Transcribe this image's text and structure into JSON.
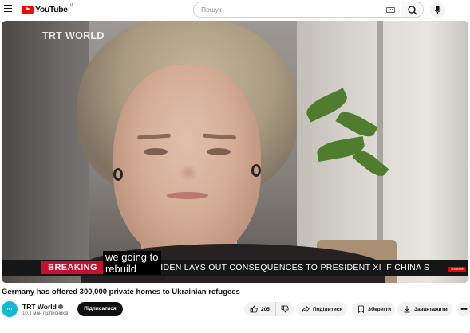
{
  "masthead": {
    "logo_text": "YouTube",
    "country_code": "UA",
    "search_placeholder": "Пошук"
  },
  "player": {
    "channel_bug": "TRT WORLD",
    "breaking_label": "BREAKING",
    "ticker_text": "BIDEN LAYS OUT CONSEQUENCES TO PRESIDENT XI IF CHINA S",
    "captions": [
      "we going to",
      "rebuild"
    ],
    "subscribe_badge": "Subscribe"
  },
  "video": {
    "title": "Germany has offered 300,000 private homes to Ukrainian refugees"
  },
  "owner": {
    "avatar_text": "TRT WORLD",
    "channel_name": "TRT World",
    "subscribers": "10,1 млн підписників",
    "subscribe_label": "Підписатися"
  },
  "actions": {
    "like_count": "205",
    "share_label": "Поділитися",
    "save_label": "Зберегти",
    "download_label": "Завантажити",
    "more_label": "•••"
  },
  "icons": [
    "menu-icon",
    "youtube-logo-icon",
    "keyboard-icon",
    "search-icon",
    "mic-icon",
    "verified-icon",
    "thumb-up-icon",
    "thumb-down-icon",
    "share-icon",
    "bookmark-icon",
    "download-icon",
    "more-icon"
  ],
  "colors": {
    "brand_red": "#ff0000",
    "breaking_red": "#c8102e",
    "avatar_cyan": "#13b8d1"
  }
}
